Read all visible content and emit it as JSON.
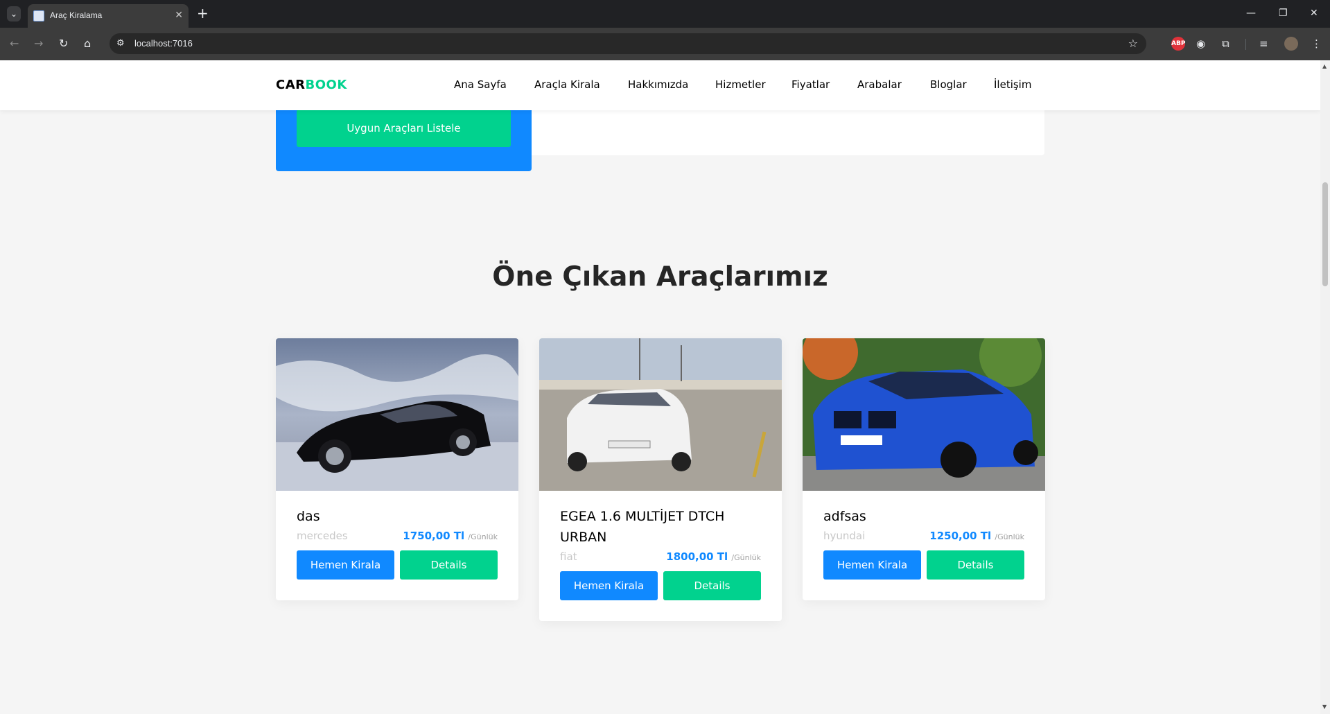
{
  "browser": {
    "tab_title": "Araç Kiralama",
    "url": "localhost:7016",
    "icons": {
      "tab_list": "chevron-down-icon",
      "close": "close-icon",
      "new_tab": "plus-icon",
      "back": "arrow-left-icon",
      "forward": "arrow-right-icon",
      "reload": "reload-icon",
      "home": "home-icon",
      "site_info": "tune-icon",
      "bookmark": "star-icon"
    },
    "extension_abp": "ABP"
  },
  "site": {
    "logo_part1": "CAR",
    "logo_part2": "BOOK",
    "nav": [
      "Ana Sayfa",
      "Araçla Kirala",
      "Hakkımızda",
      "Hizmetler",
      "Fiyatlar",
      "Arabalar",
      "Bloglar",
      "İletişim"
    ],
    "search_button": "Uygun Araçları Listele",
    "section_title": "Öne Çıkan Araçlarımız"
  },
  "cars": [
    {
      "name": "das",
      "brand": "mercedes",
      "price": "1750,00 Tl",
      "per": "/Günlük",
      "rent_label": "Hemen Kirala",
      "details_label": "Details"
    },
    {
      "name": "EGEA 1.6 MULTİJET DTCH URBAN",
      "brand": "fiat",
      "price": "1800,00 Tl",
      "per": "/Günlük",
      "rent_label": "Hemen Kirala",
      "details_label": "Details"
    },
    {
      "name": "adfsas",
      "brand": "hyundai",
      "price": "1250,00 Tl",
      "per": "/Günlük",
      "rent_label": "Hemen Kirala",
      "details_label": "Details"
    }
  ],
  "colors": {
    "brand_green": "#01d28e",
    "brand_blue": "#1089ff",
    "title": "#262626"
  }
}
